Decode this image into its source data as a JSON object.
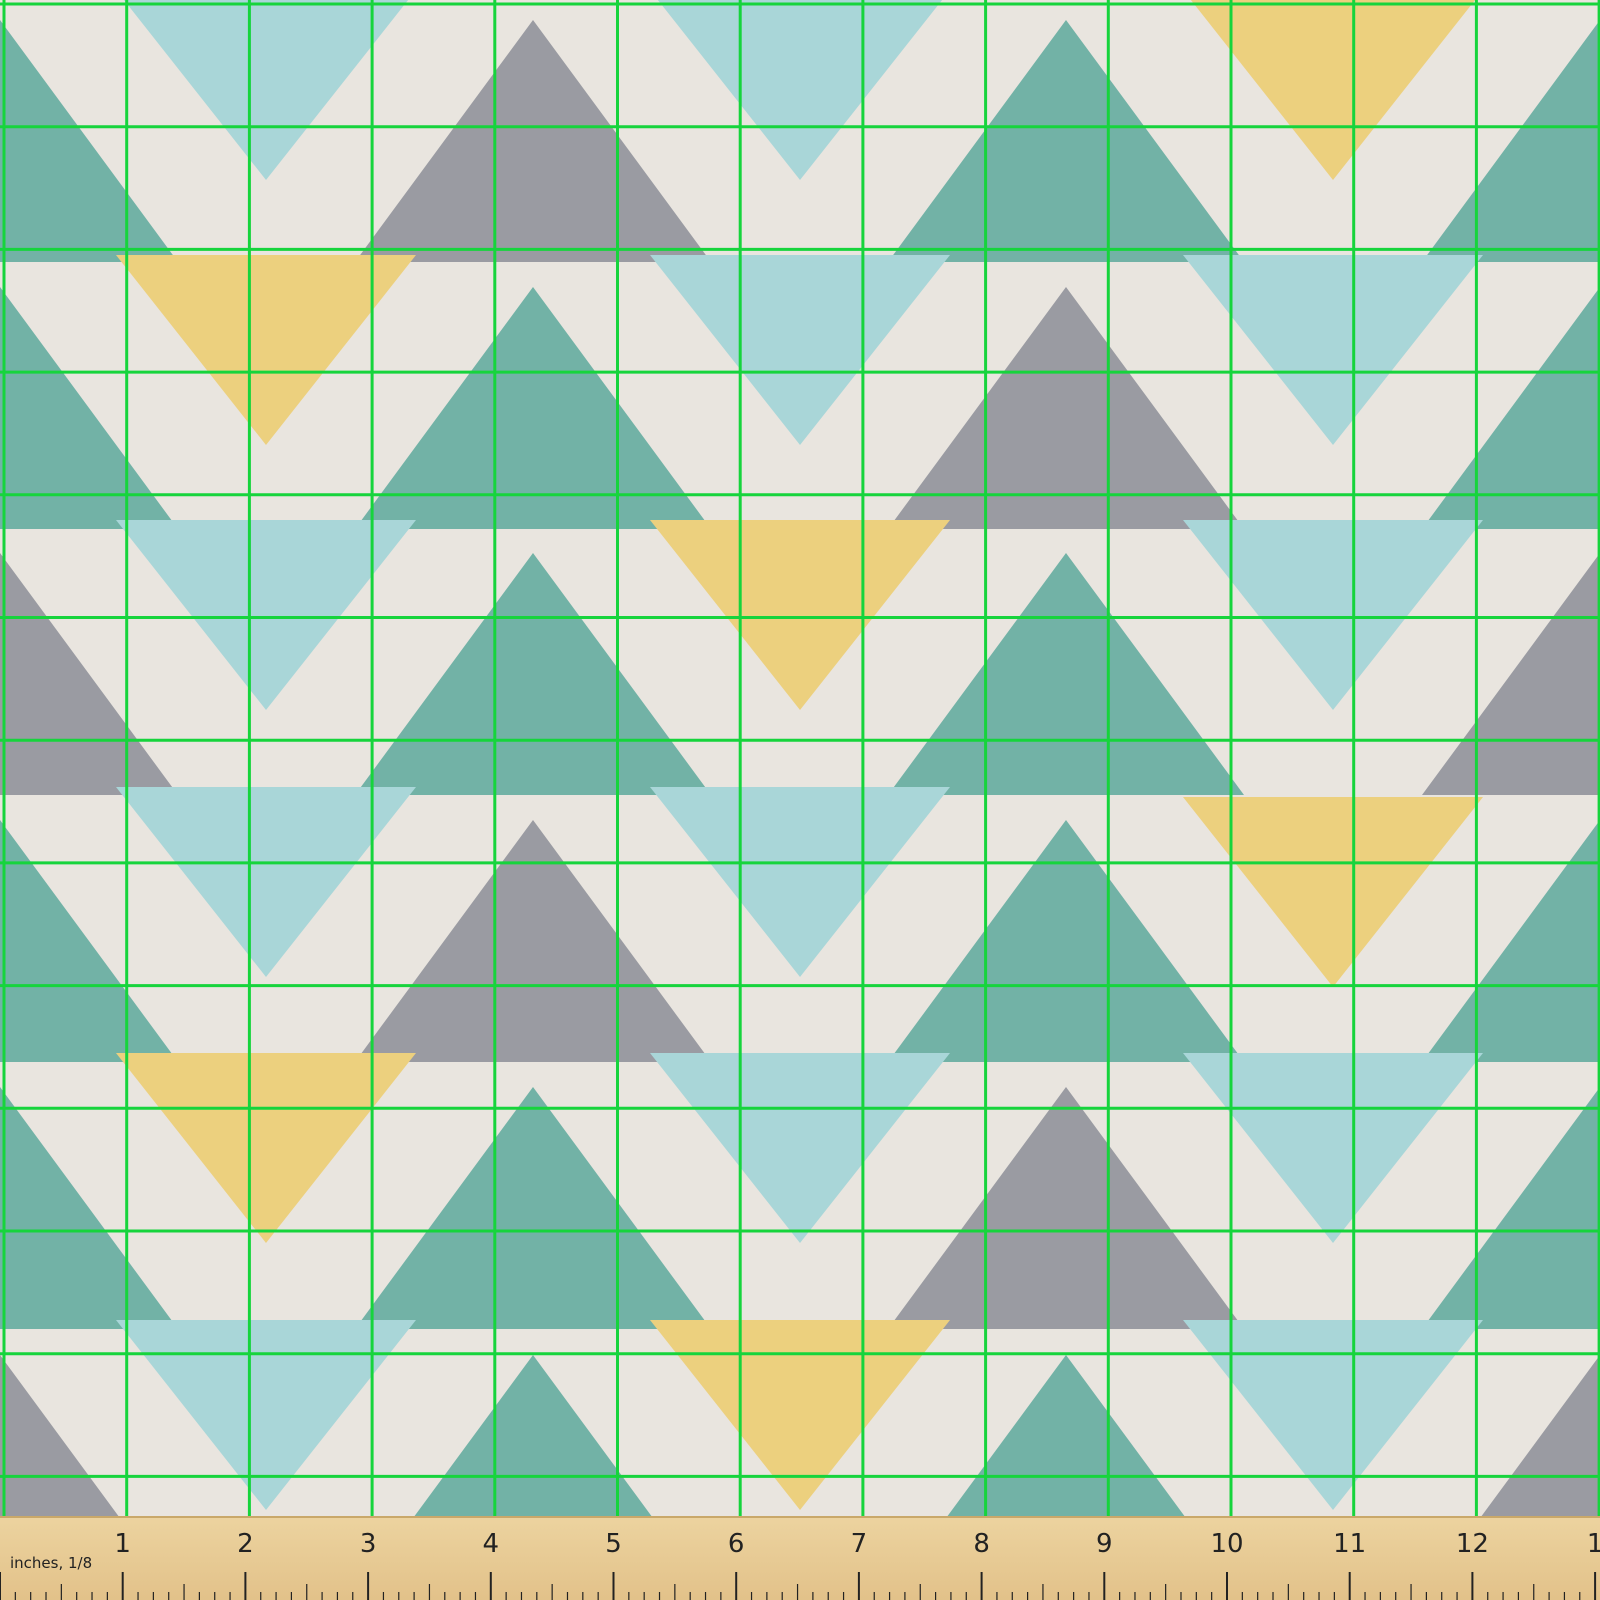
{
  "ruler": {
    "unit_label": "inches, 1/8",
    "numbers": [
      "1",
      "2",
      "3",
      "4",
      "5",
      "6",
      "7",
      "8",
      "9",
      "10",
      "11",
      "12",
      "1"
    ]
  },
  "colors": {
    "background": "#e9e5df",
    "teal": "#72b2a6",
    "aqua": "#a9d6d8",
    "gray": "#9a9ba2",
    "yellow": "#ecd07e",
    "grid": "#16d43c",
    "ruler": "#e7c892",
    "ruler_ink": "#222222"
  }
}
